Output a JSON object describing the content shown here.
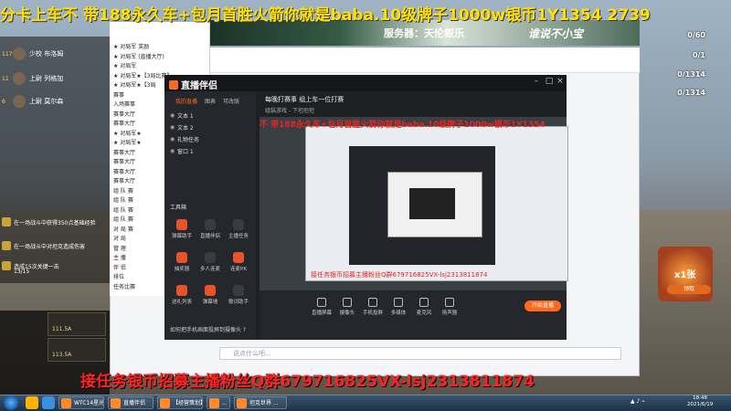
{
  "overlay": {
    "top_marquee": "分卡上车不   带188永久车+包月首胜火箭你就是baba.10级牌子1000w银币1Y1354 2739",
    "bottom_marquee": "接任务银币招募主播粉丝Q群679716825VX-lsj2313811874"
  },
  "banner": {
    "server_text": "服务器：天伦叙乐",
    "right_text": "谁说不小宝"
  },
  "game_hud": {
    "players": [
      {
        "rank": "117",
        "name": "少校 布洛姆"
      },
      {
        "rank": "11",
        "name": "上尉 列格加"
      },
      {
        "rank": "6",
        "name": "上尉 莫尔森"
      }
    ],
    "missions": [
      {
        "text": "在一场战斗中获得350点基础经验"
      },
      {
        "text": "在一场战斗中对坦克造成伤害"
      },
      {
        "text": "造成15次关键一击"
      },
      {
        "text": "13/15"
      }
    ],
    "counters": [
      "0/60",
      "0/1",
      "0/1314",
      "0/1314"
    ],
    "gift_count": "x1张",
    "gift_button": "领取"
  },
  "tank_slots": [
    {
      "label": "111.5A"
    },
    {
      "label": "113.5A"
    }
  ],
  "tree_panel": {
    "items": [
      "★ 对局军 奖励",
      "★ 对局军 (直播大厅)",
      "★ 对局军",
      "★ 对局军★【3局比赛】",
      "★ 对局军★【3局",
      "赛事",
      "入场赛事",
      "赛事大厅",
      "赛事大厅",
      "★ 对局军★",
      "★ 对局军★",
      "赛事大厅",
      "赛事大厅",
      "赛事大厅",
      "赛事大厅",
      "组 队 赛",
      "组 队 赛",
      "组 队 赛",
      "组 队 赛",
      "对 局 赛",
      "对 局",
      "管 理",
      "主 播",
      "伴 侣",
      "排位",
      "任务比赛"
    ]
  },
  "app": {
    "logo": "直播伴侣",
    "tabs": [
      "我的直播",
      "图表",
      "可改版"
    ],
    "sources": [
      {
        "name": "文本 1"
      },
      {
        "name": "文本 2"
      },
      {
        "name": "礼物任务"
      },
      {
        "name": "窗口 1"
      }
    ],
    "tools_label": "工具箱",
    "tools": [
      {
        "label": "弹幕助手",
        "hot": true
      },
      {
        "label": "直播伴侣",
        "hot": false
      },
      {
        "label": "主播任务",
        "hot": false
      },
      {
        "label": "抽奖器",
        "hot": true
      },
      {
        "label": "多人连麦",
        "hot": false
      },
      {
        "label": "连麦PK",
        "hot": true
      },
      {
        "label": "送礼列表",
        "hot": true
      },
      {
        "label": "弹幕墙",
        "hot": true
      },
      {
        "label": "歌词助手",
        "hot": false
      }
    ],
    "room_title": "每晚打赛事 组上车一位打赛",
    "room_sub": "组装游戏 - 下坦坦坦",
    "preview_marquee": "不   带188永久车+包月首胜火箭你就是baba.10级牌子1000w银币1Y1354",
    "preview_bottom_marquee": "接任务银币招募主播粉丝Q群679716825VX-lsj2313811874",
    "bottom_tools": [
      {
        "label": "直播屏幕"
      },
      {
        "label": "摄像头"
      },
      {
        "label": "手机投屏"
      },
      {
        "label": "多媒体"
      },
      {
        "label": "麦克风"
      },
      {
        "label": "扬声器"
      }
    ],
    "start_button": "开始直播",
    "camera_tip": "如何把手机画面投屏到摄像头 ?",
    "chat_placeholder": "说点什么吧..."
  },
  "taskbar": {
    "tasks": [
      {
        "label": "WTC14星光坦克大..."
      },
      {
        "label": "直播伴侣"
      },
      {
        "label": "【经营策划】 ..."
      },
      {
        "label": "..."
      },
      {
        "label": "坦克世界 ..."
      }
    ],
    "clock_time": "18:48",
    "clock_date": "2021/6/19"
  }
}
